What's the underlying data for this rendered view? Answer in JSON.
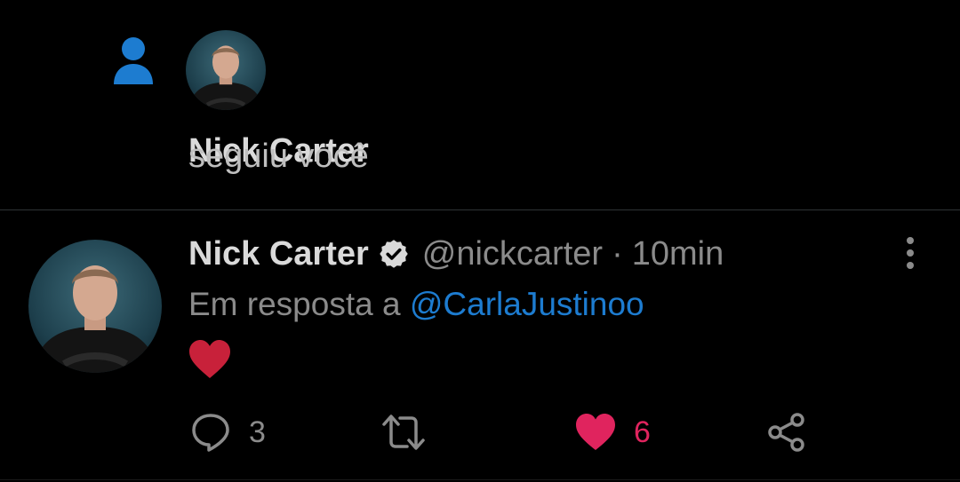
{
  "notification": {
    "name": "Nick Carter",
    "action_text": "seguiu você"
  },
  "tweet": {
    "name": "Nick Carter",
    "handle": "@nickcarter",
    "separator": "·",
    "time": "10min",
    "reply_prefix": "Em resposta a",
    "reply_mention": "@CarlaJustinoo",
    "actions": {
      "reply_count": "3",
      "retweet_count": "",
      "like_count": "6"
    }
  },
  "colors": {
    "background": "#000000",
    "accent_blue": "#1d7cd0",
    "like_pink": "#e0245e",
    "emoji_red": "#c8213a",
    "muted_text": "#8b8b8b"
  },
  "icons": {
    "follow": "person-icon",
    "verified": "verified-badge-icon",
    "more": "more-vertical-icon",
    "emoji": "red-heart-emoji",
    "reply": "reply-icon",
    "retweet": "retweet-icon",
    "like": "heart-filled-icon",
    "share": "share-icon"
  }
}
